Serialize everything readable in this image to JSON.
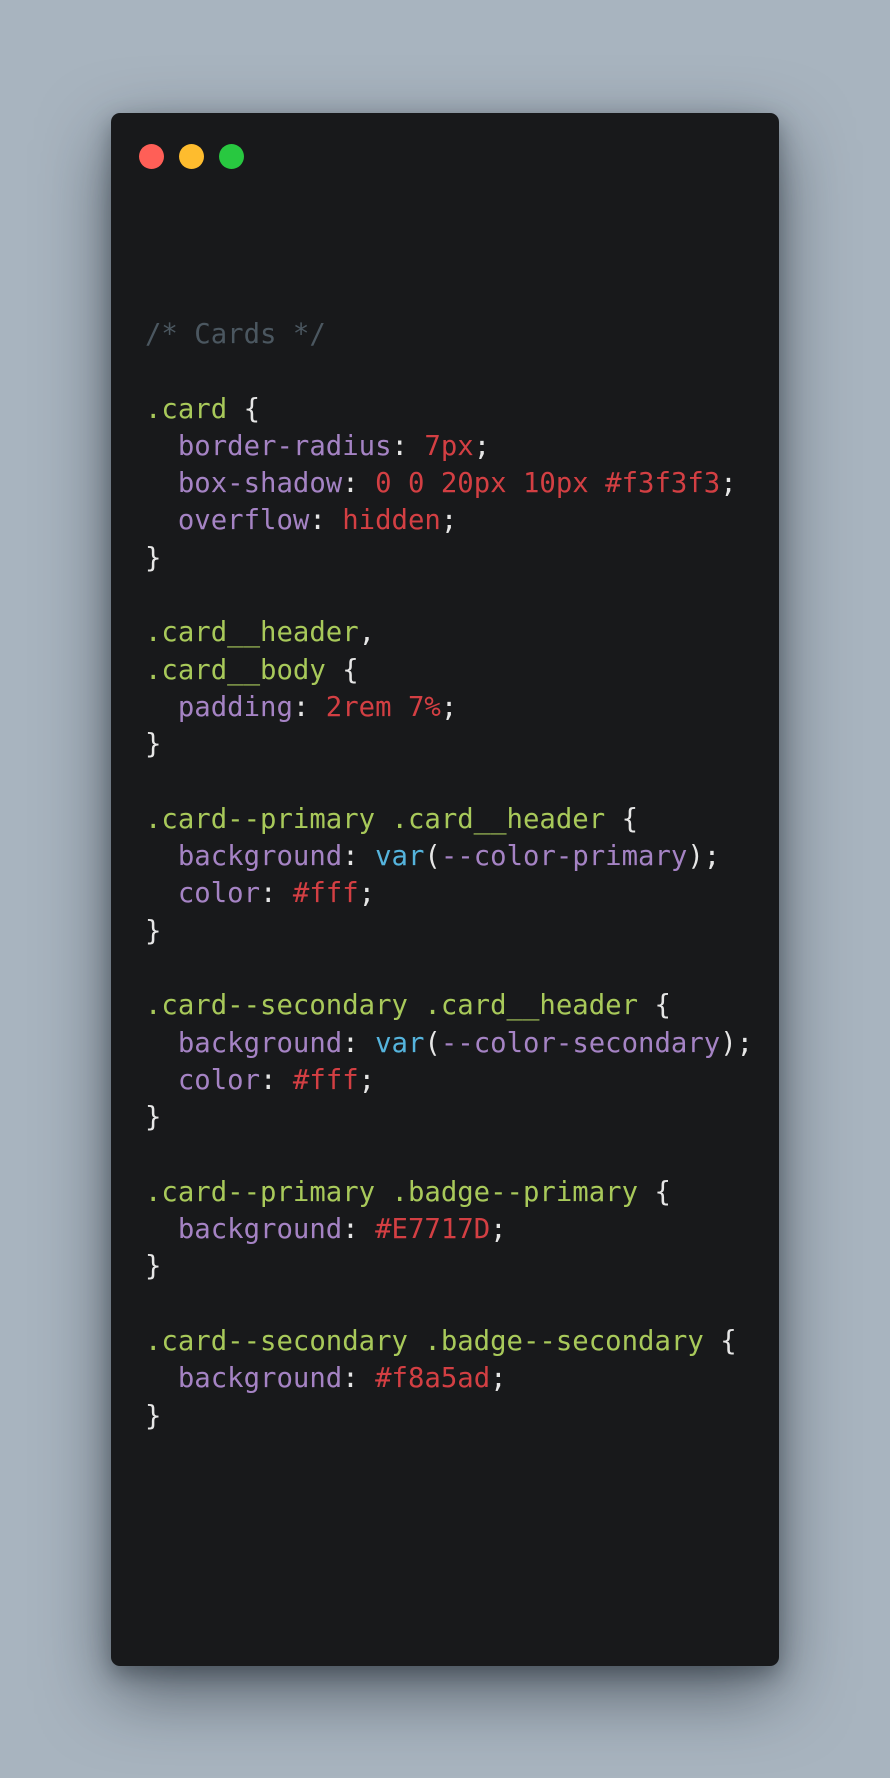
{
  "window": {
    "colors": {
      "background": "#18191b",
      "page_background": "#a8b4bf"
    },
    "traffic_lights": [
      {
        "name": "close",
        "color": "#ff5f57"
      },
      {
        "name": "minimize",
        "color": "#febc2e"
      },
      {
        "name": "maximize",
        "color": "#28c840"
      }
    ]
  },
  "syntax_colors": {
    "comment": "#4b5760",
    "selector": "#a8c95a",
    "property": "#a583c4",
    "value": "#d33f43",
    "function": "#55b4dd",
    "punctuation": "#e6e6e6"
  },
  "code": {
    "lines": [
      [
        {
          "t": "comment",
          "v": "/* Cards */"
        }
      ],
      [],
      [
        {
          "t": "selector",
          "v": ".card"
        },
        {
          "t": "punct",
          "v": " {"
        }
      ],
      [
        {
          "t": "punct",
          "v": "  "
        },
        {
          "t": "property",
          "v": "border-radius"
        },
        {
          "t": "punct",
          "v": ": "
        },
        {
          "t": "value",
          "v": "7px"
        },
        {
          "t": "punct",
          "v": ";"
        }
      ],
      [
        {
          "t": "punct",
          "v": "  "
        },
        {
          "t": "property",
          "v": "box-shadow"
        },
        {
          "t": "punct",
          "v": ": "
        },
        {
          "t": "value",
          "v": "0 0 20px 10px #f3f3f3"
        },
        {
          "t": "punct",
          "v": ";"
        }
      ],
      [
        {
          "t": "punct",
          "v": "  "
        },
        {
          "t": "property",
          "v": "overflow"
        },
        {
          "t": "punct",
          "v": ": "
        },
        {
          "t": "value",
          "v": "hidden"
        },
        {
          "t": "punct",
          "v": ";"
        }
      ],
      [
        {
          "t": "punct",
          "v": "}"
        }
      ],
      [],
      [
        {
          "t": "selector",
          "v": ".card__header"
        },
        {
          "t": "punct",
          "v": ","
        }
      ],
      [
        {
          "t": "selector",
          "v": ".card__body"
        },
        {
          "t": "punct",
          "v": " {"
        }
      ],
      [
        {
          "t": "punct",
          "v": "  "
        },
        {
          "t": "property",
          "v": "padding"
        },
        {
          "t": "punct",
          "v": ": "
        },
        {
          "t": "value",
          "v": "2rem 7%"
        },
        {
          "t": "punct",
          "v": ";"
        }
      ],
      [
        {
          "t": "punct",
          "v": "}"
        }
      ],
      [],
      [
        {
          "t": "selector",
          "v": ".card--primary .card__header"
        },
        {
          "t": "punct",
          "v": " {"
        }
      ],
      [
        {
          "t": "punct",
          "v": "  "
        },
        {
          "t": "property",
          "v": "background"
        },
        {
          "t": "punct",
          "v": ": "
        },
        {
          "t": "func",
          "v": "var"
        },
        {
          "t": "punct",
          "v": "("
        },
        {
          "t": "var",
          "v": "--color-primary"
        },
        {
          "t": "punct",
          "v": ");"
        }
      ],
      [
        {
          "t": "punct",
          "v": "  "
        },
        {
          "t": "property",
          "v": "color"
        },
        {
          "t": "punct",
          "v": ": "
        },
        {
          "t": "value",
          "v": "#fff"
        },
        {
          "t": "punct",
          "v": ";"
        }
      ],
      [
        {
          "t": "punct",
          "v": "}"
        }
      ],
      [],
      [
        {
          "t": "selector",
          "v": ".card--secondary .card__header"
        },
        {
          "t": "punct",
          "v": " {"
        }
      ],
      [
        {
          "t": "punct",
          "v": "  "
        },
        {
          "t": "property",
          "v": "background"
        },
        {
          "t": "punct",
          "v": ": "
        },
        {
          "t": "func",
          "v": "var"
        },
        {
          "t": "punct",
          "v": "("
        },
        {
          "t": "var",
          "v": "--color-secondary"
        },
        {
          "t": "punct",
          "v": ");"
        }
      ],
      [
        {
          "t": "punct",
          "v": "  "
        },
        {
          "t": "property",
          "v": "color"
        },
        {
          "t": "punct",
          "v": ": "
        },
        {
          "t": "value",
          "v": "#fff"
        },
        {
          "t": "punct",
          "v": ";"
        }
      ],
      [
        {
          "t": "punct",
          "v": "}"
        }
      ],
      [],
      [
        {
          "t": "selector",
          "v": ".card--primary .badge--primary"
        },
        {
          "t": "punct",
          "v": " {"
        }
      ],
      [
        {
          "t": "punct",
          "v": "  "
        },
        {
          "t": "property",
          "v": "background"
        },
        {
          "t": "punct",
          "v": ": "
        },
        {
          "t": "value",
          "v": "#E7717D"
        },
        {
          "t": "punct",
          "v": ";"
        }
      ],
      [
        {
          "t": "punct",
          "v": "}"
        }
      ],
      [],
      [
        {
          "t": "selector",
          "v": ".card--secondary .badge--secondary"
        },
        {
          "t": "punct",
          "v": " {"
        }
      ],
      [
        {
          "t": "punct",
          "v": "  "
        },
        {
          "t": "property",
          "v": "background"
        },
        {
          "t": "punct",
          "v": ": "
        },
        {
          "t": "value",
          "v": "#f8a5ad"
        },
        {
          "t": "punct",
          "v": ";"
        }
      ],
      [
        {
          "t": "punct",
          "v": "}"
        }
      ]
    ]
  }
}
